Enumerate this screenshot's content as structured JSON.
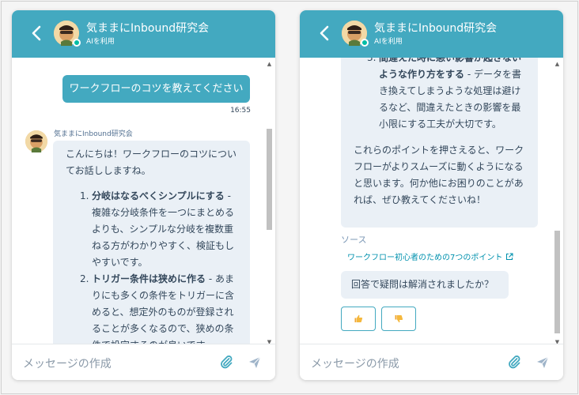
{
  "chat": {
    "title": "気ままにInbound研究会",
    "subtitle": "AIを利用",
    "composer_placeholder": "メッセージの作成",
    "bot_name": "気ままにInbound研究会"
  },
  "left_panel": {
    "user_message": "ワークフローのコツを教えてください",
    "timestamp": "16:55",
    "reply_intro": "こんにちは！ワークフローのコツについてお話ししますね。",
    "items": [
      {
        "num": "1.",
        "title": "分岐はなるべくシンプルにする",
        "body": " - 複雑な分岐条件を一つにまとめるよりも、シンプルな分岐を複数重ねる方がわかりやすく、検証もしやすいです。"
      },
      {
        "num": "2.",
        "title": "トリガー条件は狭めに作る",
        "body": " - あまりにも多くの条件をトリガーに含めると、想定外のものが登録されることが多くなるので、狭めの条件で設定するのが良いです。"
      }
    ]
  },
  "right_panel": {
    "item3": {
      "num": "3.",
      "title": "間違えた時に悪い影響が起きないような作り方をする",
      "body": " - データを書き換えてしまうような処理は避けるなど、間違えたときの影響を最小限にする工夫が大切です。"
    },
    "closing": "これらのポイントを押さえると、ワークフローがよりスムーズに動くようになると思います。何か他にお困りのことがあれば、ぜひ教えてくださいね！",
    "source_label": "ソース",
    "source_link": "ワークフロー初心者のための7つのポイント",
    "question": "回答で疑問は解消されましたか？"
  },
  "icons": {
    "back": "chevron-left-icon",
    "attach": "paperclip-icon",
    "send": "send-icon",
    "thumbs_up": "thumbs-up-icon",
    "thumbs_down": "thumbs-down-icon",
    "external": "external-link-icon"
  },
  "colors": {
    "header": "#43a9c0",
    "bubble_bot": "#eaf0f6",
    "bubble_user": "#43a9c0",
    "link": "#0091ae",
    "online": "#00bda5"
  }
}
